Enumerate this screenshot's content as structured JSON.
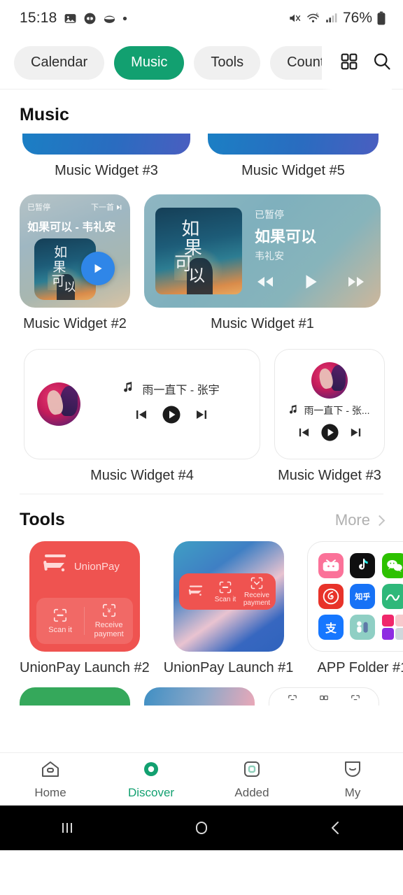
{
  "status_bar": {
    "time": "15:18",
    "battery_percent": "76%",
    "icons": [
      "gallery-icon",
      "app-badge-icon",
      "eclipse-icon",
      "dot-icon"
    ],
    "right_icons": [
      "mute-icon",
      "wifi6-icon",
      "signal-icon",
      "battery-icon"
    ]
  },
  "tabs": [
    {
      "label": "Calendar",
      "active": false
    },
    {
      "label": "Music",
      "active": true
    },
    {
      "label": "Tools",
      "active": false
    },
    {
      "label": "Countdown",
      "active": false
    }
  ],
  "tab_actions": {
    "grid": "grid-icon",
    "search": "search-icon"
  },
  "sections": [
    {
      "title": "Music",
      "more_label": "",
      "rows": [
        {
          "type": "cut-top",
          "items": [
            {
              "label": "Music Widget #3"
            },
            {
              "label": "Music Widget #5"
            }
          ]
        },
        {
          "type": "glass",
          "items": [
            {
              "label": "Music Widget #2"
            },
            {
              "label": "Music Widget #1"
            }
          ]
        },
        {
          "type": "white",
          "items": [
            {
              "label": "Music Widget #4"
            },
            {
              "label": "Music Widget #3"
            }
          ]
        }
      ]
    },
    {
      "title": "Tools",
      "more_label": "More",
      "rows": [
        {
          "type": "tools",
          "items": [
            {
              "label": "UnionPay Launch #2"
            },
            {
              "label": "UnionPay Launch #1"
            },
            {
              "label": "APP Folder #1"
            }
          ]
        }
      ]
    }
  ],
  "music_widget_2": {
    "status": "已暂停",
    "next_label": "下一首",
    "title": "如果可以 - 韦礼安",
    "play_icon": "play-icon",
    "accent": "#2f86e8"
  },
  "music_widget_1": {
    "status": "已暂停",
    "title": "如果可以",
    "artist": "韦礼安",
    "controls": [
      "rewind-icon",
      "play-icon",
      "forward-icon"
    ]
  },
  "music_widget_4": {
    "song": "雨一直下 - 张宇",
    "note_icon": "music-note-icon",
    "controls": [
      "previous-icon",
      "play-icon",
      "next-icon"
    ]
  },
  "music_widget_3": {
    "song": "雨一直下 - 张...",
    "note_icon": "music-note-icon",
    "controls": [
      "previous-icon",
      "play-icon",
      "next-icon"
    ]
  },
  "unionpay_2": {
    "brand": "UnionPay",
    "logo": "unionpay-logo-icon",
    "actions": [
      {
        "label": "Scan it",
        "icon": "scan-icon"
      },
      {
        "label": "Receive payment",
        "icon": "receive-payment-icon"
      }
    ],
    "color": "#ef5350"
  },
  "unionpay_1": {
    "logo": "unionpay-logo-icon",
    "actions": [
      {
        "label": "Scan it",
        "icon": "scan-icon"
      },
      {
        "label": "Receive payment",
        "icon": "receive-payment-icon"
      }
    ],
    "color": "#ef5350"
  },
  "app_folder": {
    "apps": [
      {
        "name": "bilibili",
        "color": "#fb7299",
        "glyph": "bilibili"
      },
      {
        "name": "douyin",
        "color": "#111111",
        "glyph": "douyin"
      },
      {
        "name": "wechat",
        "color": "#2dc100",
        "glyph": "wechat"
      },
      {
        "name": "netease-music",
        "color": "#e8332a",
        "glyph": "netease"
      },
      {
        "name": "zhihu",
        "color": "#1772f6",
        "glyph": "知乎"
      },
      {
        "name": "keep",
        "color": "#2fb87a",
        "glyph": "keep"
      },
      {
        "name": "alipay",
        "color": "#1677ff",
        "glyph": "支"
      },
      {
        "name": "health",
        "color": "#8fcfc4",
        "glyph": "health"
      },
      {
        "name": "mini-folder",
        "color": "#f2f2f2",
        "glyph": "folder"
      }
    ]
  },
  "bottom_nav": [
    {
      "label": "Home",
      "icon": "home-icon",
      "active": false
    },
    {
      "label": "Discover",
      "icon": "discover-icon",
      "active": true
    },
    {
      "label": "Added",
      "icon": "added-icon",
      "active": false
    },
    {
      "label": "My",
      "icon": "my-icon",
      "active": false
    }
  ],
  "system_nav": [
    {
      "name": "recents-button",
      "icon": "recents-icon"
    },
    {
      "name": "home-button",
      "icon": "circle-icon"
    },
    {
      "name": "back-button",
      "icon": "back-icon"
    }
  ],
  "colors": {
    "accent": "#12a070",
    "unionpay_red": "#ef5350",
    "blue": "#2f86e8"
  }
}
